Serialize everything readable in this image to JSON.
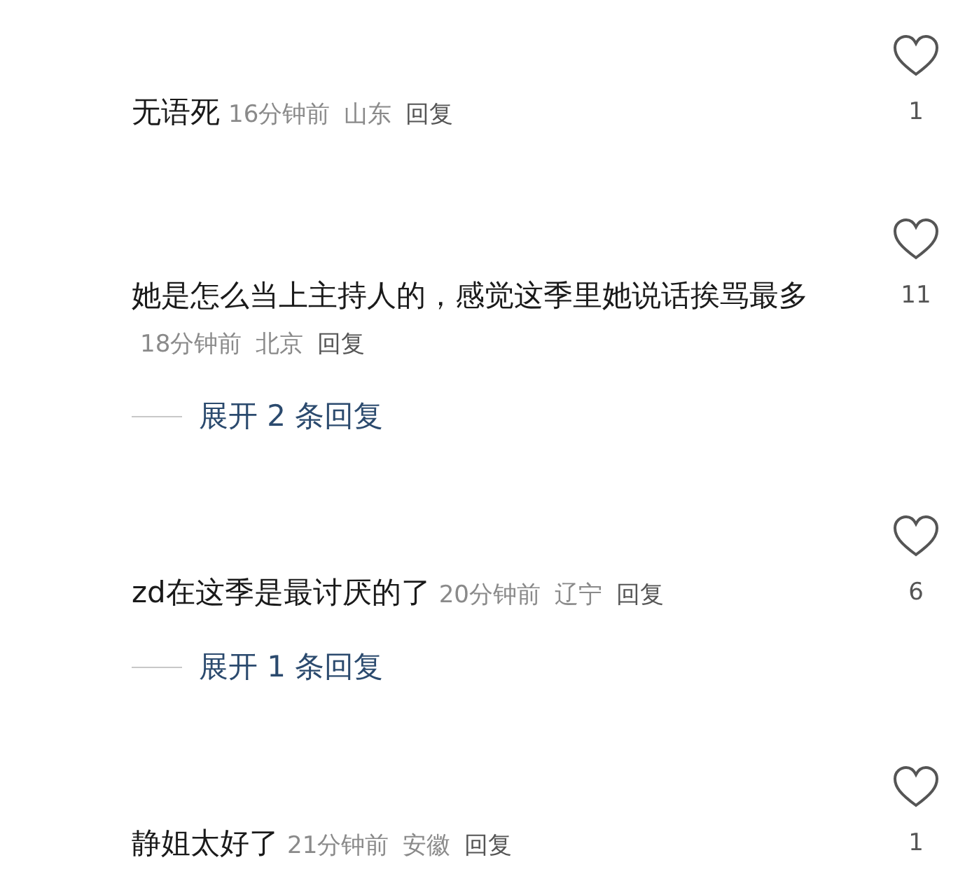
{
  "comments": [
    {
      "text": "无语死",
      "time": "16分钟前",
      "location": "山东",
      "reply": "回复",
      "likes": "1"
    },
    {
      "text": "她是怎么当上主持人的，感觉这季里她说话挨骂最多",
      "time": "18分钟前",
      "location": "北京",
      "reply": "回复",
      "likes": "11",
      "expand": "展开 2 条回复"
    },
    {
      "text": "zd在这季是最讨厌的了",
      "time": "20分钟前",
      "location": "辽宁",
      "reply": "回复",
      "likes": "6",
      "expand": "展开 1 条回复"
    },
    {
      "text": "静姐太好了",
      "time": "21分钟前",
      "location": "安徽",
      "reply": "回复",
      "likes": "1"
    }
  ]
}
